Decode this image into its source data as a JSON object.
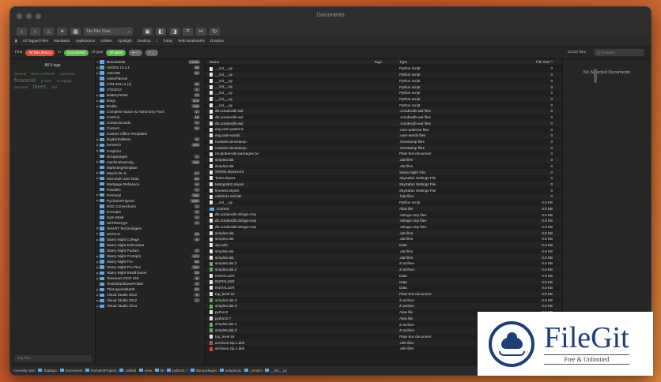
{
  "window": {
    "title": "Documents"
  },
  "toolbar": {
    "back": "‹",
    "forward": "›",
    "view_select": "No File Size",
    "view_select_arrow": "⌄"
  },
  "favorites": [
    "All Tagged Files",
    "Mandated",
    "Applications",
    "Utilities",
    "Spotlight",
    "Desktop",
    "/",
    "Today",
    "Web Bookmarks",
    "Dropbox"
  ],
  "find": {
    "label": "Find",
    "scope_value": "All files (Recu)",
    "in_label": "in",
    "folder_value": "Documents",
    "of_type_label": "of type",
    "type_value": "All types",
    "files_count": "21433 files",
    "search_placeholder": "Q Contents"
  },
  "tags": {
    "header": "All 9 tags",
    "items": [
      "Several",
      "likes-certificate",
      "important",
      "financial",
      "private",
      "mortgage",
      "personal",
      "taxes",
      "visit"
    ],
    "filter_placeholder": "Tag filter"
  },
  "tree": {
    "root": {
      "name": "Documents",
      "count": "21433"
    },
    "items": [
      {
        "name": "AirDSS 13.4.1",
        "count": "58",
        "arrow": true
      },
      {
        "name": "ASCOM",
        "count": "54",
        "arrow": true
      },
      {
        "name": "AstroPlanner",
        "count": "",
        "arrow": false
      },
      {
        "name": "ATM-4DLLs (1)",
        "count": "11",
        "arrow": false
      },
      {
        "name": "ATS2013",
        "count": "1",
        "arrow": false
      },
      {
        "name": "BatteryTester",
        "count": "79",
        "arrow": true
      },
      {
        "name": "bingo",
        "count": "473",
        "arrow": true
      },
      {
        "name": "Books",
        "count": "108",
        "arrow": true
      },
      {
        "name": "Complete Space & Astronomy Pack",
        "count": "2",
        "arrow": false
      },
      {
        "name": "ConFoo",
        "count": "16",
        "arrow": false
      },
      {
        "name": "ContactsCards",
        "count": "1",
        "arrow": false
      },
      {
        "name": "Cursors",
        "count": "24",
        "arrow": false
      },
      {
        "name": "Custom Office Templates",
        "count": "",
        "arrow": false
      },
      {
        "name": "Digital Editions",
        "count": "5",
        "arrow": true
      },
      {
        "name": "farmtech",
        "count": "529",
        "arrow": true
      },
      {
        "name": "Graphics",
        "count": "",
        "arrow": true
      },
      {
        "name": "IDropSargeit",
        "count": "1",
        "arrow": false
      },
      {
        "name": "machinelearning",
        "count": "249",
        "arrow": true
      },
      {
        "name": "MarketingTemplate",
        "count": "",
        "arrow": false
      },
      {
        "name": "Maxim DL 6",
        "count": "17",
        "arrow": true
      },
      {
        "name": "Microsoft User Data",
        "count": "64",
        "arrow": true
      },
      {
        "name": "Mortgage Refinance",
        "count": "4",
        "arrow": false
      },
      {
        "name": "Parallels",
        "count": "1",
        "arrow": false
      },
      {
        "name": "Personal",
        "count": "263",
        "arrow": true
      },
      {
        "name": "PycharmProjects",
        "count": "1983",
        "arrow": true
      },
      {
        "name": "RDC Connections",
        "count": "1",
        "arrow": false
      },
      {
        "name": "Receipts",
        "count": "2",
        "arrow": false
      },
      {
        "name": "Sam Work",
        "count": "1",
        "arrow": false
      },
      {
        "name": "SETIDecrypt",
        "count": "2",
        "arrow": false
      },
      {
        "name": "SMART Technologies",
        "count": "",
        "arrow": true
      },
      {
        "name": "SNTicon",
        "count": "23",
        "arrow": true
      },
      {
        "name": "Starry Night College",
        "count": "6",
        "arrow": true
      },
      {
        "name": "Starry Night Enthusiast",
        "count": "",
        "arrow": false
      },
      {
        "name": "Starry Night Podium",
        "count": "2",
        "arrow": false
      },
      {
        "name": "Starry Night ProEight",
        "count": "174",
        "arrow": true
      },
      {
        "name": "Starry Night Pro",
        "count": "49",
        "arrow": true
      },
      {
        "name": "Starry Night Pro Plus",
        "count": "164",
        "arrow": true
      },
      {
        "name": "Starry Night Small Dome",
        "count": "23",
        "arrow": true
      },
      {
        "name": "Tesseract-OCR IOS",
        "count": "8",
        "arrow": true
      },
      {
        "name": "TextDefaultSaveFolder",
        "count": "1",
        "arrow": false
      },
      {
        "name": "TheLayeredEarth",
        "count": "23",
        "arrow": true
      },
      {
        "name": "Visual Studio 2010",
        "count": "4",
        "arrow": true
      },
      {
        "name": "Visual Studio 2012",
        "count": "1",
        "arrow": true
      },
      {
        "name": "Visual Studio 2013",
        "count": "",
        "arrow": true
      }
    ]
  },
  "files": {
    "headers": {
      "name": "Name",
      "tags": "Tags",
      "type": "Type",
      "size": "File Size ^"
    },
    "rows": [
      {
        "name": "__init__.py",
        "type": "Python script",
        "size": "0",
        "icon": "file"
      },
      {
        "name": "__init__.py",
        "type": "Python script",
        "size": "0",
        "icon": "file"
      },
      {
        "name": "__init__.py",
        "type": "Python script",
        "size": "0",
        "icon": "file"
      },
      {
        "name": "__init__.py",
        "type": "Python script",
        "size": "0",
        "icon": "file"
      },
      {
        "name": "__init__.py",
        "type": "Python script",
        "size": "0",
        "icon": "file"
      },
      {
        "name": "__init__.py",
        "type": "Python script",
        "size": "0",
        "icon": "file"
      },
      {
        "name": "__init__.py",
        "type": "Python script",
        "size": "0",
        "icon": "file"
      },
      {
        "name": "db.xcindexdb-wal",
        "type": ".xcindexdb-wal files",
        "size": "0",
        "icon": "file"
      },
      {
        "name": "db.xcindexdb-wal",
        "type": ".xcindexdb-wal files",
        "size": "0",
        "icon": "file"
      },
      {
        "name": "db.xcindexdb-wal",
        "type": ".xcindexdb-wal files",
        "size": "0",
        "icon": "file"
      },
      {
        "name": "eng.user-patterns",
        "type": ".user-patterns files",
        "size": "0",
        "icon": "file"
      },
      {
        "name": "eng.user-words",
        "type": ".user-words files",
        "size": "0",
        "icon": "file"
      },
      {
        "name": "modules.timestamp",
        "type": ".timestamp files",
        "size": "0",
        "icon": "file"
      },
      {
        "name": "modules.timestamp",
        "type": ".timestamp files",
        "size": "0",
        "icon": "file"
      },
      {
        "name": "no-global-site-packages.txt",
        "type": "Plain text document",
        "size": "0",
        "icon": "file"
      },
      {
        "name": "simple2.dat",
        "type": ".dat files",
        "size": "0",
        "icon": "file"
      },
      {
        "name": "simple3.dat",
        "type": ".dat files",
        "size": "0",
        "icon": "file"
      },
      {
        "name": "SSTest.skyset.snt",
        "type": "Starry Night File",
        "size": "0",
        "icon": "file"
      },
      {
        "name": "Test4.skyset",
        "type": "SkySafari Settings File",
        "size": "0",
        "icon": "file"
      },
      {
        "name": "testsgrids2.skyset",
        "type": "SkySafari Settings File",
        "size": "0",
        "icon": "file"
      },
      {
        "name": "timetest.skyset",
        "type": "SkySafari Settings File",
        "size": "0",
        "icon": "file"
      },
      {
        "name": "untitled1.snt.bak",
        "type": ".bak files",
        "size": "0",
        "icon": "file"
      },
      {
        "name": "__init__.py",
        "type": "Python script",
        "size": "0.0 KB",
        "icon": "file"
      },
      {
        "name": "Current",
        "type": "Alias file",
        "size": "0.0 KB",
        "icon": "folder"
      },
      {
        "name": "db.xcindexdb.strings-cmp",
        "type": ".strings-cmp files",
        "size": "0.0 KB",
        "icon": "file"
      },
      {
        "name": "db.xcindexdb.strings-cmp",
        "type": ".strings-cmp files",
        "size": "0.0 KB",
        "icon": "file"
      },
      {
        "name": "db.xcindexdb.strings-cmp",
        "type": ".strings-cmp files",
        "size": "0.0 KB",
        "icon": "file"
      },
      {
        "name": "simple4.dat",
        "type": ".dat files",
        "size": "0.0 KB",
        "icon": "file"
      },
      {
        "name": "simple4.dat",
        "type": ".dat files",
        "size": "0.0 KB",
        "icon": "file"
      },
      {
        "name": "zip-safe",
        "type": "Data",
        "size": "0.0 KB",
        "icon": "file"
      },
      {
        "name": "simple5.dat",
        "type": ".dat files",
        "size": "0.0 KB",
        "icon": "file"
      },
      {
        "name": "simple5.dat",
        "type": ".dat files",
        "size": "0.0 KB",
        "icon": "file"
      },
      {
        "name": "simple3.dat.Z",
        "type": "Z archive",
        "size": "0.0 KB",
        "icon": "zip"
      },
      {
        "name": "simple3.dat.Z",
        "type": "Z archive",
        "size": "0.0 KB",
        "icon": "zip"
      },
      {
        "name": "INSTALLER",
        "type": "Data",
        "size": "0.0 KB",
        "icon": "file"
      },
      {
        "name": "INSTALLER",
        "type": "Data",
        "size": "0.0 KB",
        "icon": "file"
      },
      {
        "name": "INSTALLER",
        "type": "Data",
        "size": "0.0 KB",
        "icon": "file"
      },
      {
        "name": "top_level.txt",
        "type": "Plain text document",
        "size": "0.0 KB",
        "icon": "file"
      },
      {
        "name": "simple4.dat.Z",
        "type": "Z archive",
        "size": "0.0 KB",
        "icon": "zip"
      },
      {
        "name": "simple4.dat.Z",
        "type": "Z archive",
        "size": "0.0 KB",
        "icon": "zip"
      },
      {
        "name": "python2",
        "type": "Alias file",
        "size": "0.0 KB",
        "icon": "file"
      },
      {
        "name": "python2.7",
        "type": "Alias file",
        "size": "0.0 KB",
        "icon": "file"
      },
      {
        "name": "simple5.dat.Z",
        "type": "Z archive",
        "size": "0.0 KB",
        "icon": "zip"
      },
      {
        "name": "simple5.dat.Z",
        "type": "Z archive",
        "size": "0.0 KB",
        "icon": "zip"
      },
      {
        "name": "top_level.txt",
        "type": "Plain text document",
        "size": "0.0 KB",
        "icon": "file"
      },
      {
        "name": "archive2.zip.1.deb",
        "type": ".deb files",
        "size": "0.0 KB",
        "icon": "deb"
      },
      {
        "name": "archive2.zip.1.deb",
        "type": ".deb files",
        "size": "0.0 KB",
        "icon": "deb"
      }
    ]
  },
  "preview": {
    "text": "No Selected Documents"
  },
  "path": {
    "label": "Currently over:",
    "segments": [
      "shattapa",
      "Documents",
      "PycharmProjects",
      "untitled",
      "venv",
      "lib",
      "python2.7",
      "site-packages",
      "setuptools",
      "_vendor",
      "__init__.py"
    ]
  },
  "watermark": {
    "title": "FileGit",
    "subtitle": "Free & Unlimited"
  }
}
